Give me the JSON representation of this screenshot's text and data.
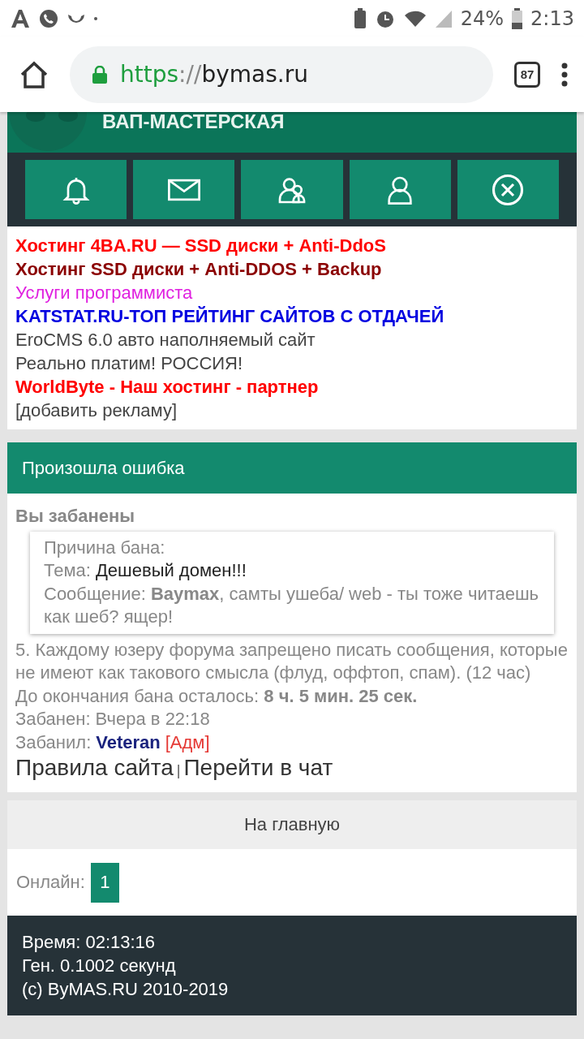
{
  "status_bar": {
    "battery": "24%",
    "time": "2:13"
  },
  "browser": {
    "url_scheme": "https",
    "url_separator": "://",
    "url_host": "bymas.ru",
    "tab_count": "87"
  },
  "banner": {
    "title": "ВАП-МАСТЕРСКАЯ"
  },
  "ads": [
    {
      "text": "Хостинг 4BA.RU — SSD диски + Anti-DdoS",
      "color": "#ff0000",
      "kind": "bold"
    },
    {
      "text": "Хостинг SSD диски + Anti-DDOS + Backup",
      "color": "#8b0000",
      "kind": "bold"
    },
    {
      "text": "Услуги программиста",
      "color": "#e020e0",
      "kind": "plain"
    },
    {
      "text": "KATSTAT.RU-ТОП РЕЙТИНГ САЙТОВ С ОТДАЧЕЙ",
      "color": "#0000e0",
      "kind": "bold"
    },
    {
      "text": "EroCMS 6.0 авто наполняемый сайт",
      "color": "#444444",
      "kind": "plain"
    },
    {
      "text": "Реально платим! РОССИЯ!",
      "color": "#444444",
      "kind": "plain"
    },
    {
      "text": "WorldByte - Наш хостинг - партнер",
      "color": "#ff0000",
      "kind": "bold"
    },
    {
      "text": "[добавить рекламу]",
      "color": "#444444",
      "kind": "plain"
    }
  ],
  "error": {
    "title": "Произошла ошибка",
    "heading": "Вы забанены",
    "reason": {
      "title": "Причина бана:",
      "topic_label": "Тема:",
      "topic_value": "Дешевый домен!!!",
      "message": "Сообщение: **Baymax**, самты ушеба/ web - ты тоже читаешь как шеб? ящер!"
    },
    "rule": "5. Каждому юзеру форума запрещено писать сообщения, которые не имеют как такового смысла (флуд, оффтоп, спам). (12 час)",
    "remaining": "До окончания бана осталось: **8 ч. 5 мин. 25 сек.**",
    "banned_at": "Забанен: Вчера в 22:18",
    "banned_by_label": "Забанил:",
    "banned_by_user": "Veteran",
    "banned_by_role": "[Адм]",
    "links": [
      "Правила сайта",
      "Перейти в чат"
    ],
    "link_separator": "|"
  },
  "home_link": "На главную",
  "online": {
    "label": "Онлайн:",
    "count": "1"
  },
  "footer": [
    "Время: 02:13:16",
    "Ген. 0.1002 секунд",
    "(c) ByMAS.RU 2010-2019"
  ]
}
